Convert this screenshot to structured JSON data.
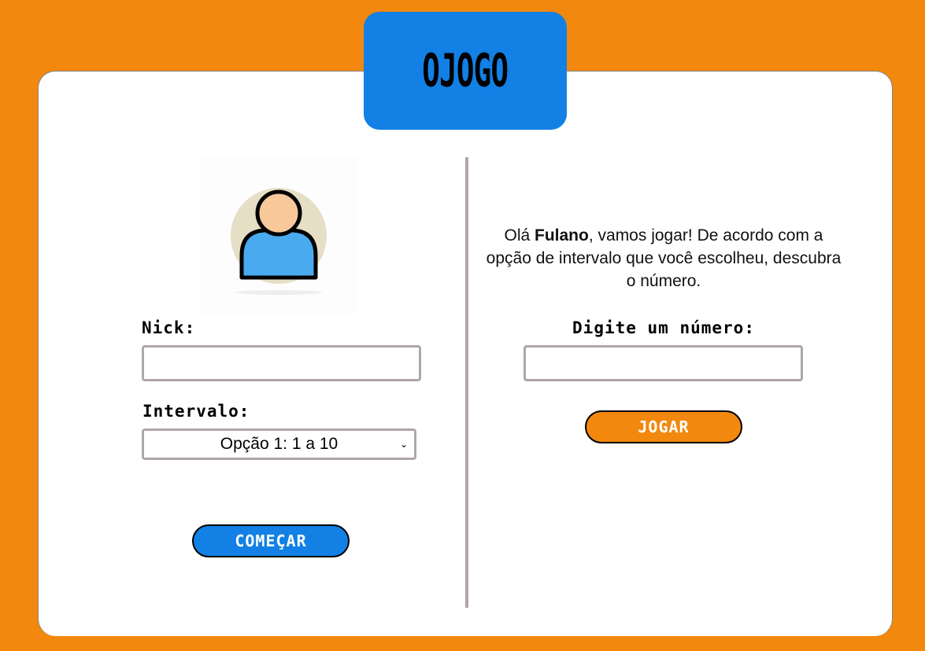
{
  "header": {
    "title": "OJOGO"
  },
  "left": {
    "nick_label": "Nick:",
    "nick_value": "",
    "interval_label": "Intervalo:",
    "interval_selected": "Opção 1: 1 a 10",
    "start_button": "COMEÇAR"
  },
  "right": {
    "greeting_prefix": "Olá ",
    "player_name": "Fulano",
    "greeting_suffix": ", vamos jogar! De acordo com a opção de intervalo que você escolheu, descubra o número.",
    "number_label": "Digite um número:",
    "number_value": "",
    "play_button": "JOGAR"
  },
  "colors": {
    "background": "#f2880e",
    "accent": "#1280e5"
  }
}
